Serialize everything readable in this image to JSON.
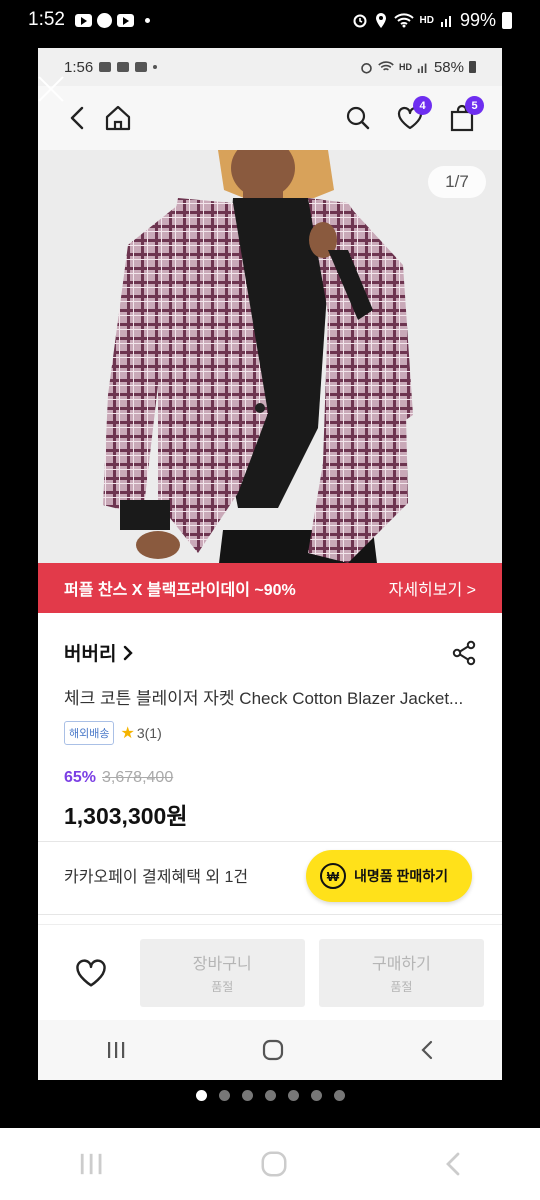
{
  "outer_status": {
    "time": "1:52",
    "battery": "99%",
    "hd_label": "HD"
  },
  "inner_status": {
    "time": "1:56",
    "battery": "58%",
    "hd_label": "HD"
  },
  "header": {
    "wishlist_badge": "4",
    "cart_badge": "5"
  },
  "hero": {
    "image_counter": "1/7",
    "promo_text": "퍼플 찬스 X 블랙프라이데이 ~90%",
    "promo_more": "자세히보기 >"
  },
  "product": {
    "brand": "버버리",
    "name": "체크 코튼 블레이저 자켓 Check Cotton Blazer Jacket...",
    "tag": "해외배송",
    "rating": "3(1)",
    "discount": "65%",
    "original_price": "3,678,400",
    "price": "1,303,300원"
  },
  "payment": {
    "benefit_text": "카카오페이 결제혜택 외 1건",
    "sell_button": "내명품 판매하기",
    "sell_icon": "₩"
  },
  "bottom": {
    "cart_label": "장바구니",
    "cart_sub": "품절",
    "buy_label": "구매하기",
    "buy_sub": "품절"
  },
  "colors": {
    "accent": "#6e2ef0",
    "promo": "#e23a4a",
    "discount": "#7b3fe4",
    "sell_button": "#ffe11a"
  },
  "icons": [
    "close-icon",
    "back-icon",
    "home-icon",
    "search-icon",
    "heart-icon",
    "bag-icon",
    "share-icon",
    "chevron-right-icon",
    "star-icon",
    "won-icon",
    "recent-apps-icon",
    "home-nav-icon",
    "back-nav-icon"
  ]
}
